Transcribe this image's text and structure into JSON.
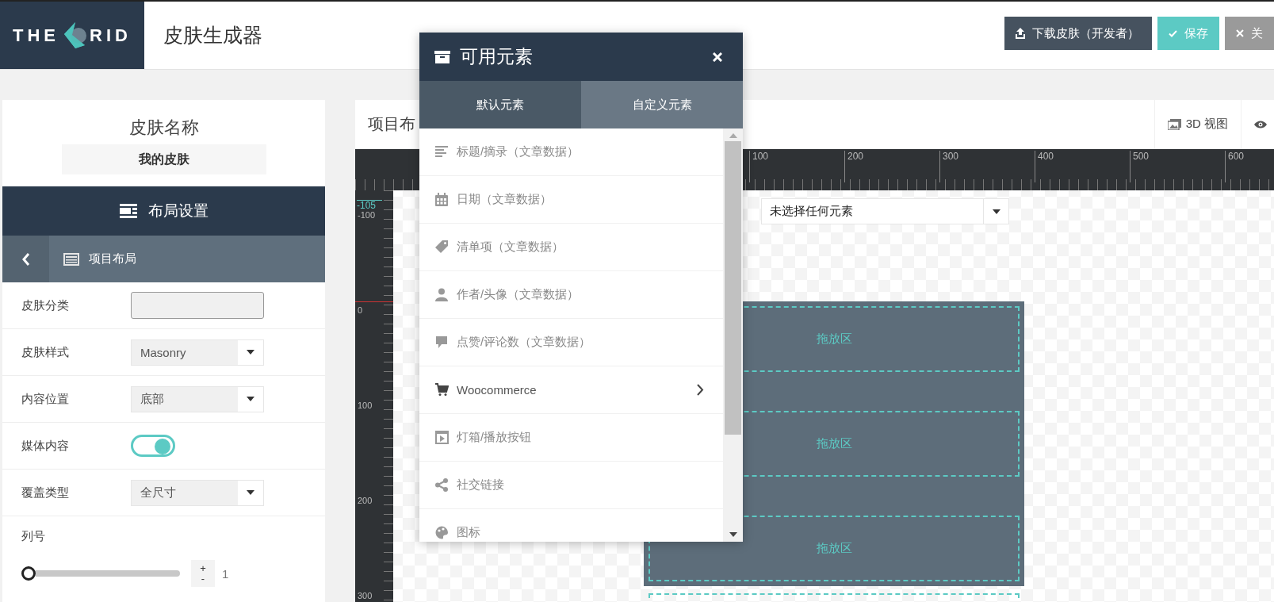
{
  "header": {
    "logo_left": "THE",
    "logo_right": "RID",
    "title": "皮肤生成器",
    "buttons": [
      {
        "kind": "download",
        "label": "下载皮肤（开发者）"
      },
      {
        "kind": "save",
        "label": "保存"
      },
      {
        "kind": "close",
        "label": "关"
      }
    ]
  },
  "sidebar": {
    "name_label": "皮肤名称",
    "name_value": "我的皮肤",
    "section_title": "布局设置",
    "subsection_title": "项目布局",
    "fields": [
      {
        "kind": "input",
        "label": "皮肤分类"
      },
      {
        "kind": "select",
        "label": "皮肤样式",
        "value": "Masonry"
      },
      {
        "kind": "select",
        "label": "内容位置",
        "value": "底部"
      },
      {
        "kind": "toggle",
        "label": "媒体内容",
        "on": true
      },
      {
        "kind": "select",
        "label": "覆盖类型",
        "value": "全尺寸"
      },
      {
        "kind": "slider",
        "label": "列号",
        "level": 0,
        "increment": "+",
        "decrement": "-",
        "value": "1"
      }
    ]
  },
  "main": {
    "title": "项目布",
    "toolbar": [
      {
        "kind": "view3d",
        "label": "3D 视图"
      },
      {
        "kind": "preview"
      }
    ],
    "canvas": {
      "x_ruler": [
        "100",
        "200",
        "300",
        "400",
        "500",
        "600"
      ],
      "y_ruler": [
        "-100",
        "0",
        "100",
        "200",
        "300"
      ],
      "marker": "-105",
      "element_select": {
        "value": "未选择任何元素"
      },
      "drop_zones": [
        "拖放区",
        "拖放区",
        "拖放区"
      ]
    }
  },
  "popup": {
    "title": "可用元素",
    "tabs": [
      {
        "label": "默认元素",
        "selected": true
      },
      {
        "label": "自定义元素",
        "selected": false
      }
    ],
    "items": [
      {
        "kind": "lines",
        "label": "标题/摘录（文章数据）",
        "has_submenu": false
      },
      {
        "kind": "calendar",
        "label": "日期（文章数据）",
        "has_submenu": false
      },
      {
        "kind": "tag",
        "label": "清单项（文章数据）",
        "has_submenu": false
      },
      {
        "kind": "person",
        "label": "作者/头像（文章数据）",
        "has_submenu": false
      },
      {
        "kind": "bubble",
        "label": "点赞/评论数（文章数据）",
        "has_submenu": false
      },
      {
        "kind": "cart",
        "label": "Woocommerce",
        "has_submenu": true
      },
      {
        "kind": "play",
        "label": "灯箱/播放按钮",
        "has_submenu": false
      },
      {
        "kind": "share",
        "label": "社交链接",
        "has_submenu": false
      },
      {
        "kind": "palette",
        "label": "图标",
        "has_submenu": false
      }
    ]
  }
}
